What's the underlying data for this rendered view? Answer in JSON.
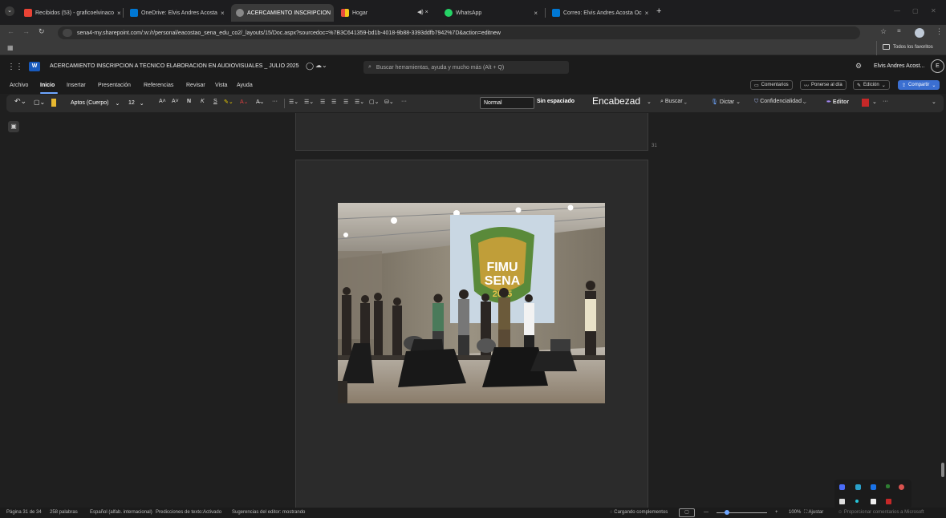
{
  "browser": {
    "tabs": [
      {
        "label": "Recibidos (53) - graficoelvinaco",
        "close": "×"
      },
      {
        "label": "OneDrive: Elvis Andres Acosta",
        "close": "×"
      },
      {
        "label": "ACERCAMIENTO INSCRIPCION",
        "close": "×"
      },
      {
        "label": "Hogar",
        "close": ""
      },
      {
        "label": "WhatsApp",
        "close": "×"
      },
      {
        "label": "Correo: Elvis Andres Acosta Oc",
        "close": "×"
      }
    ],
    "new_tab": "+",
    "window_controls": [
      "—",
      "▢",
      "✕"
    ],
    "mute_label": "◀)",
    "mute_close": "×",
    "url": "sena4-my.sharepoint.com/:w:/r/personal/eacostao_sena_edu_co2/_layouts/15/Doc.aspx?sourcedoc=%7B3C641359-bd1b-4018-9b88-3393ddfb7942%7D&action=editnew",
    "bookmarks_all": "Todos los favoritos"
  },
  "word": {
    "doc_title": "ACERCAMIENTO INSCRIPCION A TECNICO ELABORACION EN AUDIOVISUALES _ JULIO 2025",
    "search_placeholder": "Buscar herramientas, ayuda y mucho más (Alt + Q)",
    "user_name": "Elvis Andres Acost...",
    "avatar_initial": "E",
    "menus": [
      "Archivo",
      "Inicio",
      "Insertar",
      "Presentación",
      "Referencias",
      "Revisar",
      "Vista",
      "Ayuda"
    ],
    "right_buttons": {
      "comments": "Comentarios",
      "catchup": "Ponerse al día",
      "editing": "Edición",
      "share": "Compartir"
    },
    "ribbon": {
      "font": "Aptos (Cuerpo)",
      "size": "12",
      "bold": "N",
      "italic": "K",
      "underline": "S",
      "style_normal": "Normal",
      "style_nospacing": "Sin espaciado",
      "style_heading": "Encabezad",
      "find": "Buscar",
      "dictate": "Dictar",
      "sensitivity": "Confidencialidad",
      "editor": "Editor",
      "more": "···"
    },
    "page_number_marker": "31"
  },
  "photo": {
    "banner_line1": "FIMU",
    "banner_line2": "SENA",
    "banner_year": "2025"
  },
  "status": {
    "page": "Página 31 de 34",
    "words": "258 palabras",
    "language": "Español (alfab. internacional)",
    "predictions": "Predicciones de texto:Activado",
    "suggestions": "Sugerencias del editor: mostrando",
    "loading": "Cargando complementos",
    "zoom": "100%",
    "fit": "Ajustar",
    "feedback": "Proporcionar comentarios a Microsoft"
  },
  "colors": {
    "accent": "#3b6fd1",
    "gmail": "#ea4335",
    "onedrive": "#0078d4",
    "whatsapp": "#25d366"
  }
}
